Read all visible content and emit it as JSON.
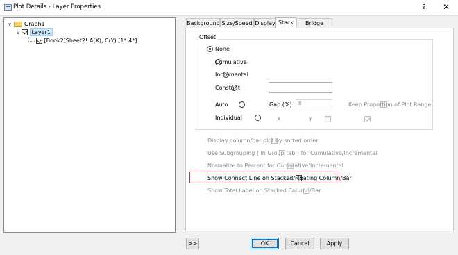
{
  "window": {
    "title": "Plot Details - Layer Properties",
    "help": "?",
    "close": "✕"
  },
  "tree": {
    "graph": "Graph1",
    "layer": "Layer1",
    "plot": "[Book2]Sheet2! A(X), C(Y) [1*:4*]"
  },
  "tabs": [
    "Background",
    "Size/Speed",
    "Display",
    "Stack",
    "Bridge Chart"
  ],
  "active_tab": "Stack",
  "offset": {
    "legend": "Offset",
    "none": "None",
    "cumulative": "Cumulative",
    "incremental": "Incremental",
    "constant": "Constant",
    "auto": "Auto",
    "individual": "Individual",
    "selected": "None",
    "gap_label": "Gap (%)",
    "gap_value": "8",
    "keep_proportion": "Keep Proportion of Plot Range",
    "x_label": "X",
    "y_label": "Y"
  },
  "options": {
    "sorted_order": "Display column/bar plot by sorted order",
    "subgrouping": "Use Subgrouping ( in Group tab ) for Cumulative/Incremental",
    "normalize": "Normalize to Percent for Cumulative/Incremental",
    "connect_line": "Show Connect Line on Stacked/Floating Column/Bar",
    "total_label": "Show Total Label on Stacked Column/Bar"
  },
  "buttons": {
    "expand": ">>",
    "ok": "OK",
    "cancel": "Cancel",
    "apply": "Apply"
  },
  "colors": {
    "highlight": "#e0282e",
    "selection": "#cce8ff",
    "accent": "#0078d7"
  }
}
